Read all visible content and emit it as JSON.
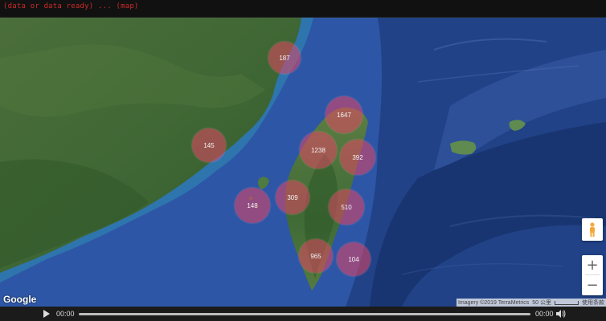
{
  "status": {
    "message": "(data or data ready) ... (map)"
  },
  "map": {
    "provider": "Google",
    "attribution": {
      "imagery": "Imagery ©2019 TerraMetrics",
      "scale": "50 公里",
      "terms": "使用条款"
    },
    "controls": {
      "pegman_icon": "pegman-icon",
      "zoom_in": "+",
      "zoom_out": "−"
    },
    "clusters": [
      {
        "label": "187"
      },
      {
        "label": "1647"
      },
      {
        "label": "145"
      },
      {
        "label": "1238"
      },
      {
        "label": "392"
      },
      {
        "label": "148"
      },
      {
        "label": "309"
      },
      {
        "label": "510"
      },
      {
        "label": "965"
      },
      {
        "label": "104"
      }
    ]
  },
  "player": {
    "current_time": "00:00",
    "duration": "00:00",
    "play_icon": "play-icon",
    "volume_icon": "volume-icon"
  },
  "colors": {
    "cluster": "#e64664",
    "sea": "#2a4a8e",
    "land": "#3f6a34",
    "player_bar": "#1b1b1b",
    "status_text": "#cf2a2a"
  }
}
